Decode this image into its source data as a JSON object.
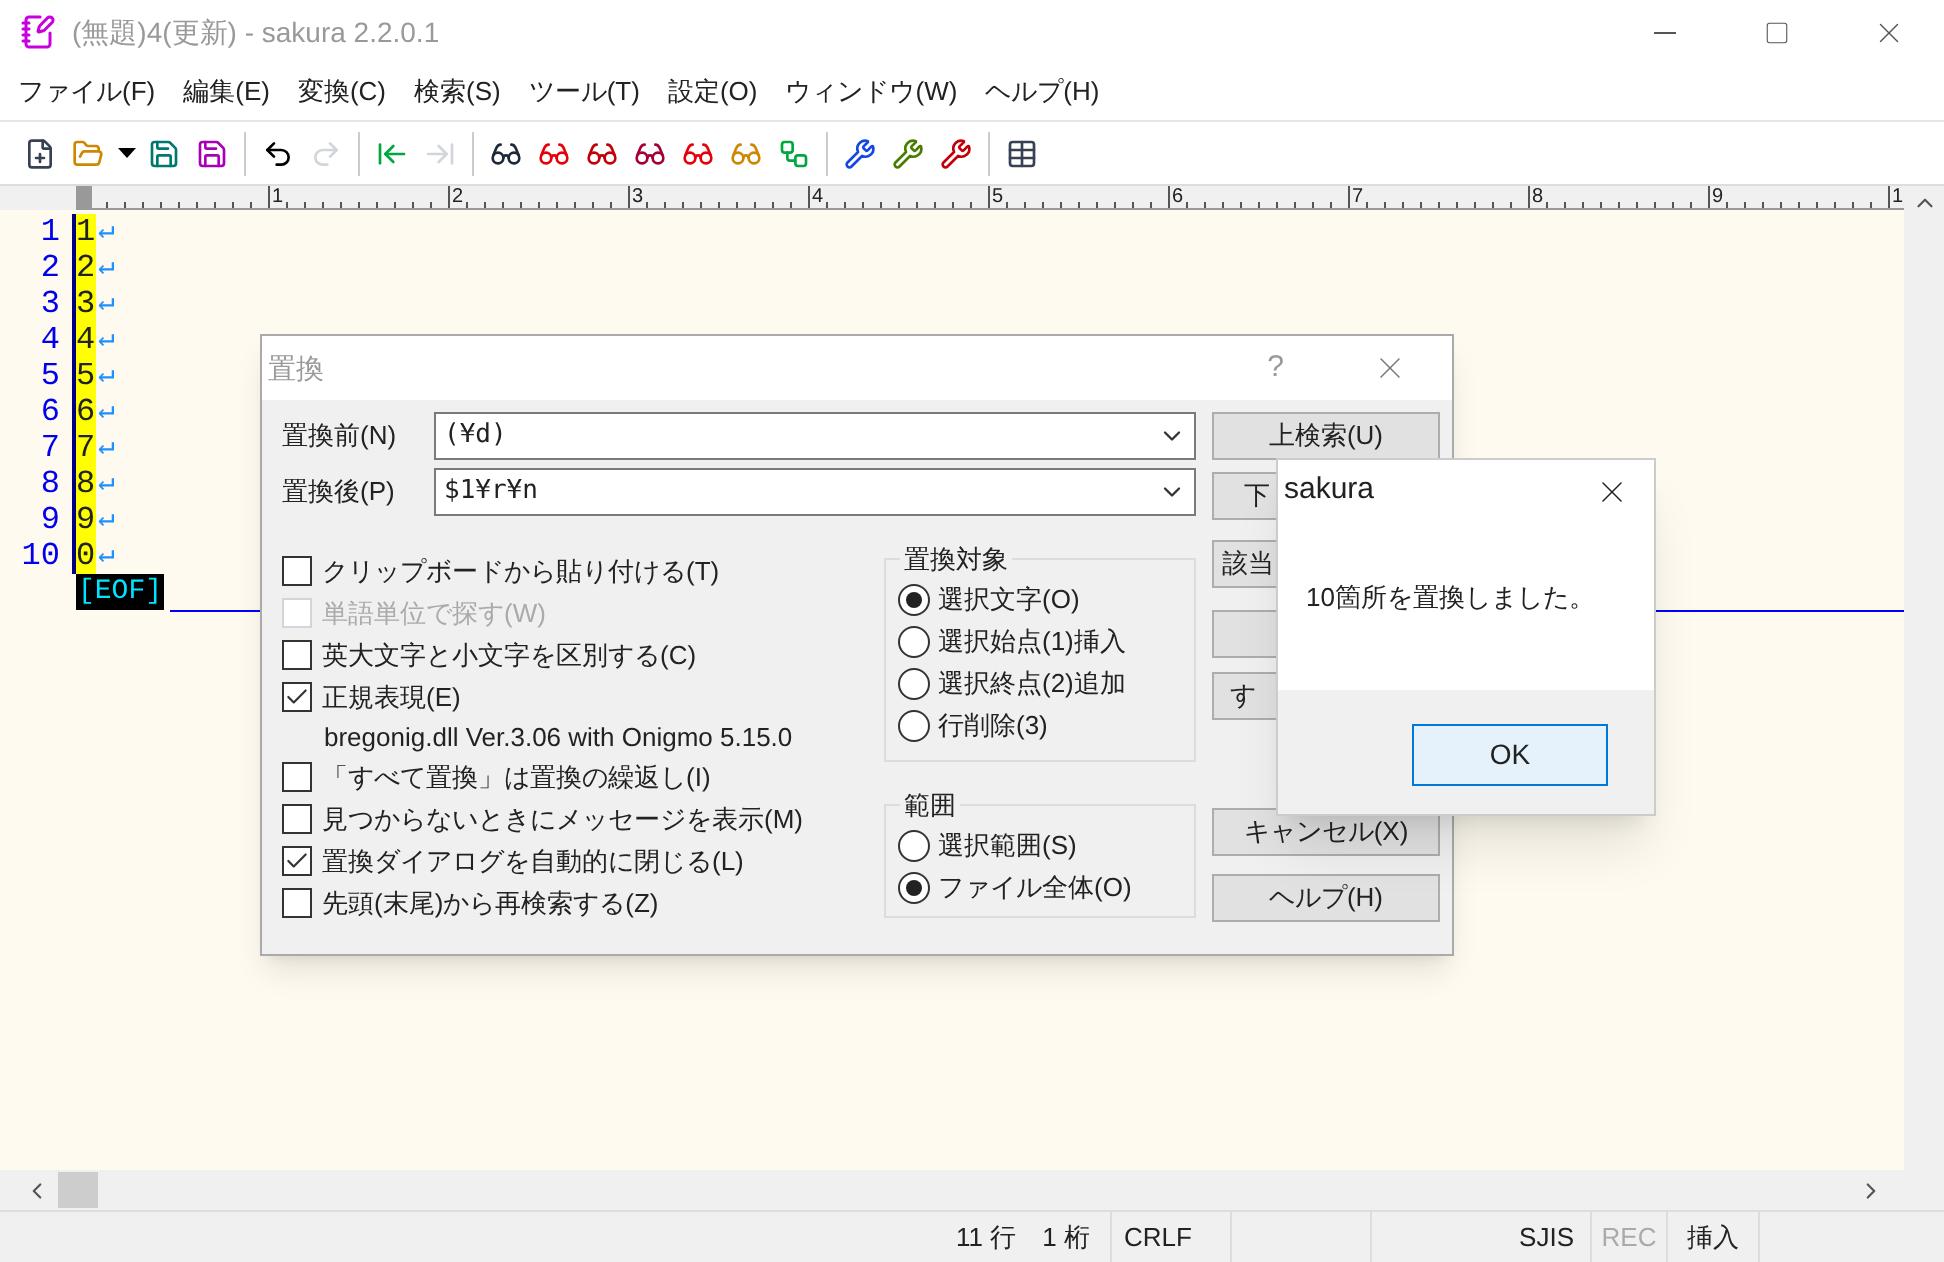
{
  "window": {
    "title": "(無題)4(更新) - sakura 2.2.0.1"
  },
  "menu": [
    "ファイル(F)",
    "編集(E)",
    "変換(C)",
    "検索(S)",
    "ツール(T)",
    "設定(O)",
    "ウィンドウ(W)",
    "ヘルプ(H)"
  ],
  "toolbar": [
    {
      "disabled": false
    },
    {
      "disabled": false
    },
    {
      "disabled": false
    },
    {
      "disabled": false
    },
    {
      "disabled": false
    },
    {
      "disabled": false
    },
    {
      "disabled": true
    },
    {
      "disabled": false
    },
    {
      "disabled": true
    },
    {
      "disabled": false
    },
    {
      "disabled": false
    },
    {
      "disabled": false
    },
    {
      "disabled": false
    },
    {
      "disabled": false
    },
    {
      "disabled": false
    },
    {
      "disabled": false
    },
    {
      "disabled": false
    },
    {
      "disabled": false
    },
    {
      "disabled": false
    },
    {
      "disabled": false
    }
  ],
  "ruler": [
    "1",
    "2",
    "3",
    "4",
    "5",
    "6",
    "7",
    "8",
    "9",
    "1"
  ],
  "lines": [
    {
      "number": "1",
      "text": "1",
      "eol": "↵"
    },
    {
      "number": "2",
      "text": "2",
      "eol": "↵"
    },
    {
      "number": "3",
      "text": "3",
      "eol": "↵"
    },
    {
      "number": "4",
      "text": "4",
      "eol": "↵"
    },
    {
      "number": "5",
      "text": "5",
      "eol": "↵"
    },
    {
      "number": "6",
      "text": "6",
      "eol": "↵"
    },
    {
      "number": "7",
      "text": "7",
      "eol": "↵"
    },
    {
      "number": "8",
      "text": "8",
      "eol": "↵"
    },
    {
      "number": "9",
      "text": "9",
      "eol": "↵"
    },
    {
      "number": "10",
      "text": "0",
      "eol": "↵"
    }
  ],
  "eof": "[EOF]",
  "replace_dialog": {
    "title": "置換",
    "help": "?",
    "find_label": "置換前(N)",
    "find_value": "(¥d)",
    "replace_label": "置換後(P)",
    "replace_value": "$1¥r¥n",
    "buttons": [
      "上検索(U)",
      "下",
      "該当",
      "す",
      "キャンセル(X)",
      "ヘルプ(H)"
    ],
    "options": [
      {
        "kind": "checkbox",
        "label": "クリップボードから貼り付ける(T)",
        "checked": false,
        "disabled": false
      },
      {
        "kind": "checkbox",
        "label": "単語単位で探す(W)",
        "checked": false,
        "disabled": true
      },
      {
        "kind": "checkbox",
        "label": "英大文字と小文字を区別する(C)",
        "checked": false,
        "disabled": false
      },
      {
        "kind": "checkbox",
        "label": "正規表現(E)",
        "checked": true,
        "disabled": false
      },
      {
        "kind": "note",
        "label": "bregonig.dll Ver.3.06 with Onigmo 5.15.0"
      },
      {
        "kind": "checkbox",
        "label": "「すべて置換」は置換の繰返し(I)",
        "checked": false,
        "disabled": false
      },
      {
        "kind": "checkbox",
        "label": "見つからないときにメッセージを表示(M)",
        "checked": false,
        "disabled": false
      },
      {
        "kind": "checkbox",
        "label": "置換ダイアログを自動的に閉じる(L)",
        "checked": true,
        "disabled": false
      },
      {
        "kind": "checkbox",
        "label": "先頭(末尾)から再検索する(Z)",
        "checked": false,
        "disabled": false
      }
    ],
    "target_title": "置換対象",
    "targets": [
      {
        "label": "選択文字(O)",
        "selected": true
      },
      {
        "label": "選択始点(1)挿入",
        "selected": false
      },
      {
        "label": "選択終点(2)追加",
        "selected": false
      },
      {
        "label": "行削除(3)",
        "selected": false
      }
    ],
    "range_title": "範囲",
    "ranges": [
      {
        "label": "選択範囲(S)",
        "selected": false
      },
      {
        "label": "ファイル全体(O)",
        "selected": true
      }
    ]
  },
  "message_box": {
    "title": "sakura",
    "message": "10箇所を置換しました。",
    "ok": "OK"
  },
  "status_bar": [
    {
      "text": "11 行　1 桁",
      "disabled": false
    },
    {
      "text": "CRLF",
      "disabled": false
    },
    {
      "text": "SJIS",
      "disabled": false
    },
    {
      "text": "REC",
      "disabled": true
    },
    {
      "text": "挿入",
      "disabled": false
    }
  ]
}
